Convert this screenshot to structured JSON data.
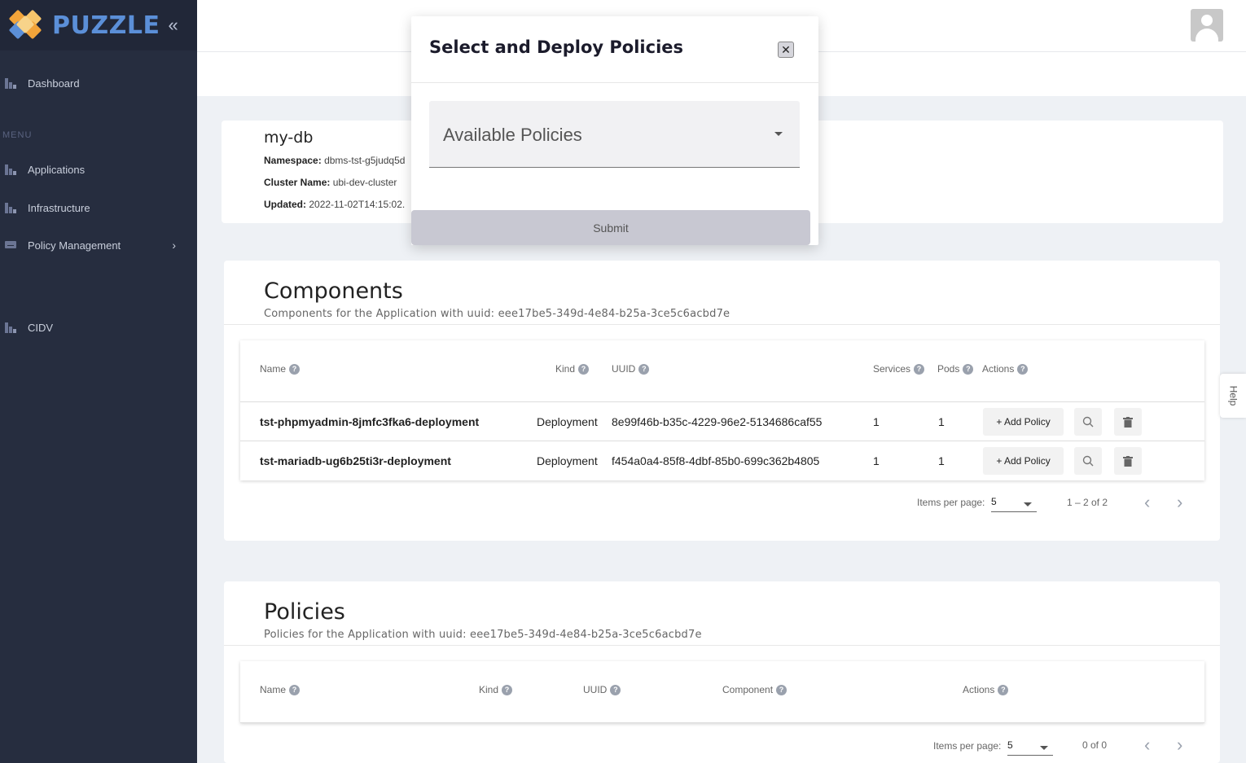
{
  "brand": {
    "name": "PUZZLE",
    "collapse_icon": "«"
  },
  "sidebar": {
    "menu_label": "MENU",
    "items": [
      {
        "label": "Dashboard"
      },
      {
        "label": "Applications"
      },
      {
        "label": "Infrastructure"
      },
      {
        "label": "Policy Management",
        "chevron": "›"
      },
      {
        "label": "CIDV"
      }
    ]
  },
  "app": {
    "name": "my-db",
    "namespace_label": "Namespace:",
    "namespace_value": "dbms-tst-g5judq5d",
    "cluster_label": "Cluster Name:",
    "cluster_value": "ubi-dev-cluster",
    "updated_label": "Updated:",
    "updated_value": "2022-11-02T14:15:02."
  },
  "components": {
    "title": "Components",
    "subtitle": "Components for the Application with uuid: eee17be5-349d-4e84-b25a-3ce5c6acbd7e",
    "columns": [
      "Name",
      "Kind",
      "UUID",
      "Services",
      "Pods",
      "Actions"
    ],
    "rows": [
      {
        "name": "tst-phpmyadmin-8jmfc3fka6-deployment",
        "kind": "Deployment",
        "uuid": "8e99f46b-b35c-4229-96e2-5134686caf55",
        "services": "1",
        "pods": "1"
      },
      {
        "name": "tst-mariadb-ug6b25ti3r-deployment",
        "kind": "Deployment",
        "uuid": "f454a0a4-85f8-4dbf-85b0-699c362b4805",
        "services": "1",
        "pods": "1"
      }
    ],
    "add_policy_label": "+ Add Policy",
    "items_per_page_label": "Items per page:",
    "items_per_page": "5",
    "range": "1 – 2 of 2"
  },
  "policies": {
    "title": "Policies",
    "subtitle": "Policies for the Application with uuid: eee17be5-349d-4e84-b25a-3ce5c6acbd7e",
    "columns": [
      "Name",
      "Kind",
      "UUID",
      "Component",
      "Actions"
    ],
    "items_per_page_label": "Items per page:",
    "items_per_page": "5",
    "range": "0 of 0"
  },
  "help_tab": "Help",
  "modal": {
    "title": "Select and Deploy Policies",
    "close": "✕",
    "select_placeholder": "Available Policies",
    "submit": "Submit"
  },
  "help_icon_glyph": "?",
  "pager_prev": "‹",
  "pager_next": "›",
  "colors": {
    "sidebar": "#262d3f",
    "brand": "#5b8fd8",
    "logo_orange": "#f2a43a",
    "logo_blue": "#5b8fd8"
  }
}
